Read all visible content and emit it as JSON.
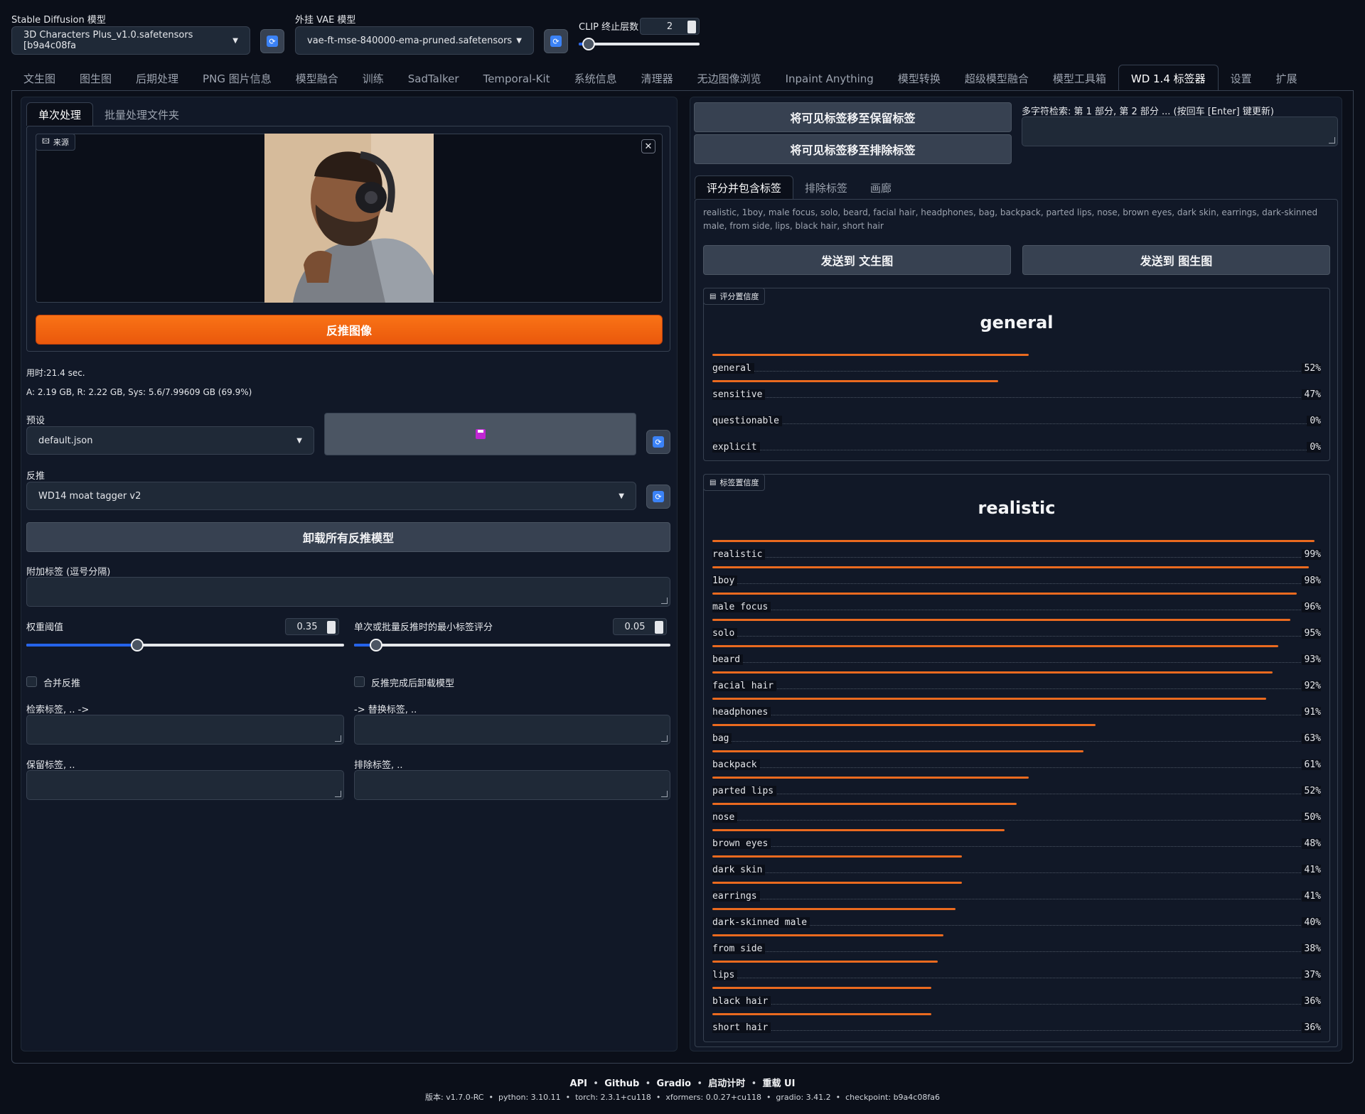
{
  "top": {
    "sd_model_label": "Stable Diffusion 模型",
    "sd_model_value": "3D Characters Plus_v1.0.safetensors [b9a4c08fa",
    "vae_label": "外挂 VAE 模型",
    "vae_value": "vae-ft-mse-840000-ema-pruned.safetensors",
    "clip_label": "CLIP 终止层数",
    "clip_value": "2",
    "clip_slider_fraction": 0.08
  },
  "tabs": [
    "文生图",
    "图生图",
    "后期处理",
    "PNG 图片信息",
    "模型融合",
    "训练",
    "SadTalker",
    "Temporal-Kit",
    "系统信息",
    "清理器",
    "无边图像浏览",
    "Inpaint Anything",
    "模型转换",
    "超级模型融合",
    "模型工具箱",
    "WD 1.4 标签器",
    "设置",
    "扩展"
  ],
  "selected_tab": "WD 1.4 标签器",
  "left": {
    "subtabs": [
      "单次处理",
      "批量处理文件夹"
    ],
    "source_label": "来源",
    "interrogate_button": "反推图像",
    "time_text": "用时:21.4 sec.",
    "mem_text": "A: 2.19 GB, R: 2.22 GB, Sys: 5.6/7.99609 GB (69.9%)",
    "preset_label": "预设",
    "preset_value": "default.json",
    "interrogator_label": "反推",
    "interrogator_value": "WD14 moat tagger v2",
    "unload_button": "卸载所有反推模型",
    "additional_tags_label": "附加标签 (逗号分隔)",
    "weight_threshold_label": "权重阈值",
    "weight_threshold_value": "0.35",
    "weight_threshold_fraction": 0.35,
    "min_score_label": "单次或批量反推时的最小标签评分",
    "min_score_value": "0.05",
    "min_score_fraction": 0.07,
    "cumulative_label": "合并反推",
    "unload_after_label": "反推完成后卸载模型",
    "search_tags_label": "检索标签, .. ->",
    "replace_tags_label": "-> 替换标签, ..",
    "keep_tags_label": "保留标签, ..",
    "exclude_tags_label": "排除标签, .."
  },
  "right": {
    "move_keep_button": "将可见标签移至保留标签",
    "move_exclude_button": "将可见标签移至排除标签",
    "search_label": "多字符检索: 第 1 部分, 第 2 部分 ... (按回车 [Enter] 键更新)",
    "subtabs": [
      "评分并包含标签",
      "排除标签",
      "画廊"
    ],
    "tags_text": "realistic, 1boy, male focus, solo, beard, facial hair, headphones, bag, backpack, parted lips, nose, brown eyes, dark skin, earrings, dark-skinned male, from side, lips, black hair, short hair",
    "send_txt2img": "发送到 文生图",
    "send_img2img": "发送到 图生图",
    "rating_badge": "评分置信度",
    "rating_title": "general",
    "ratings": [
      {
        "name": "general",
        "value": 0.52,
        "pct": "52%"
      },
      {
        "name": "sensitive",
        "value": 0.47,
        "pct": "47%"
      },
      {
        "name": "questionable",
        "value": 0.0,
        "pct": "0%"
      },
      {
        "name": "explicit",
        "value": 0.0,
        "pct": "0%"
      }
    ],
    "tag_badge": "标签置信度",
    "tag_title": "realistic",
    "tag_confidences": [
      {
        "name": "realistic",
        "value": 0.99,
        "pct": "99%"
      },
      {
        "name": "1boy",
        "value": 0.98,
        "pct": "98%"
      },
      {
        "name": "male focus",
        "value": 0.96,
        "pct": "96%"
      },
      {
        "name": "solo",
        "value": 0.95,
        "pct": "95%"
      },
      {
        "name": "beard",
        "value": 0.93,
        "pct": "93%"
      },
      {
        "name": "facial hair",
        "value": 0.92,
        "pct": "92%"
      },
      {
        "name": "headphones",
        "value": 0.91,
        "pct": "91%"
      },
      {
        "name": "bag",
        "value": 0.63,
        "pct": "63%"
      },
      {
        "name": "backpack",
        "value": 0.61,
        "pct": "61%"
      },
      {
        "name": "parted lips",
        "value": 0.52,
        "pct": "52%"
      },
      {
        "name": "nose",
        "value": 0.5,
        "pct": "50%"
      },
      {
        "name": "brown eyes",
        "value": 0.48,
        "pct": "48%"
      },
      {
        "name": "dark skin",
        "value": 0.41,
        "pct": "41%"
      },
      {
        "name": "earrings",
        "value": 0.41,
        "pct": "41%"
      },
      {
        "name": "dark-skinned male",
        "value": 0.4,
        "pct": "40%"
      },
      {
        "name": "from side",
        "value": 0.38,
        "pct": "38%"
      },
      {
        "name": "lips",
        "value": 0.37,
        "pct": "37%"
      },
      {
        "name": "black hair",
        "value": 0.36,
        "pct": "36%"
      },
      {
        "name": "short hair",
        "value": 0.36,
        "pct": "36%"
      }
    ]
  },
  "footer": {
    "links": [
      "API",
      "Github",
      "Gradio",
      "启动计时",
      "重载 UI"
    ],
    "version_line": "版本: v1.7.0-RC  •  python: 3.10.11  •  torch: 2.3.1+cu118  •  xformers: 0.0.27+cu118  •  gradio: 3.41.2  •  checkpoint: b9a4c08fa6"
  },
  "colors": {
    "accent": "#ea580c",
    "bar": "#ea6a1f",
    "slider": "#2563eb",
    "background": "#0b0f19"
  }
}
